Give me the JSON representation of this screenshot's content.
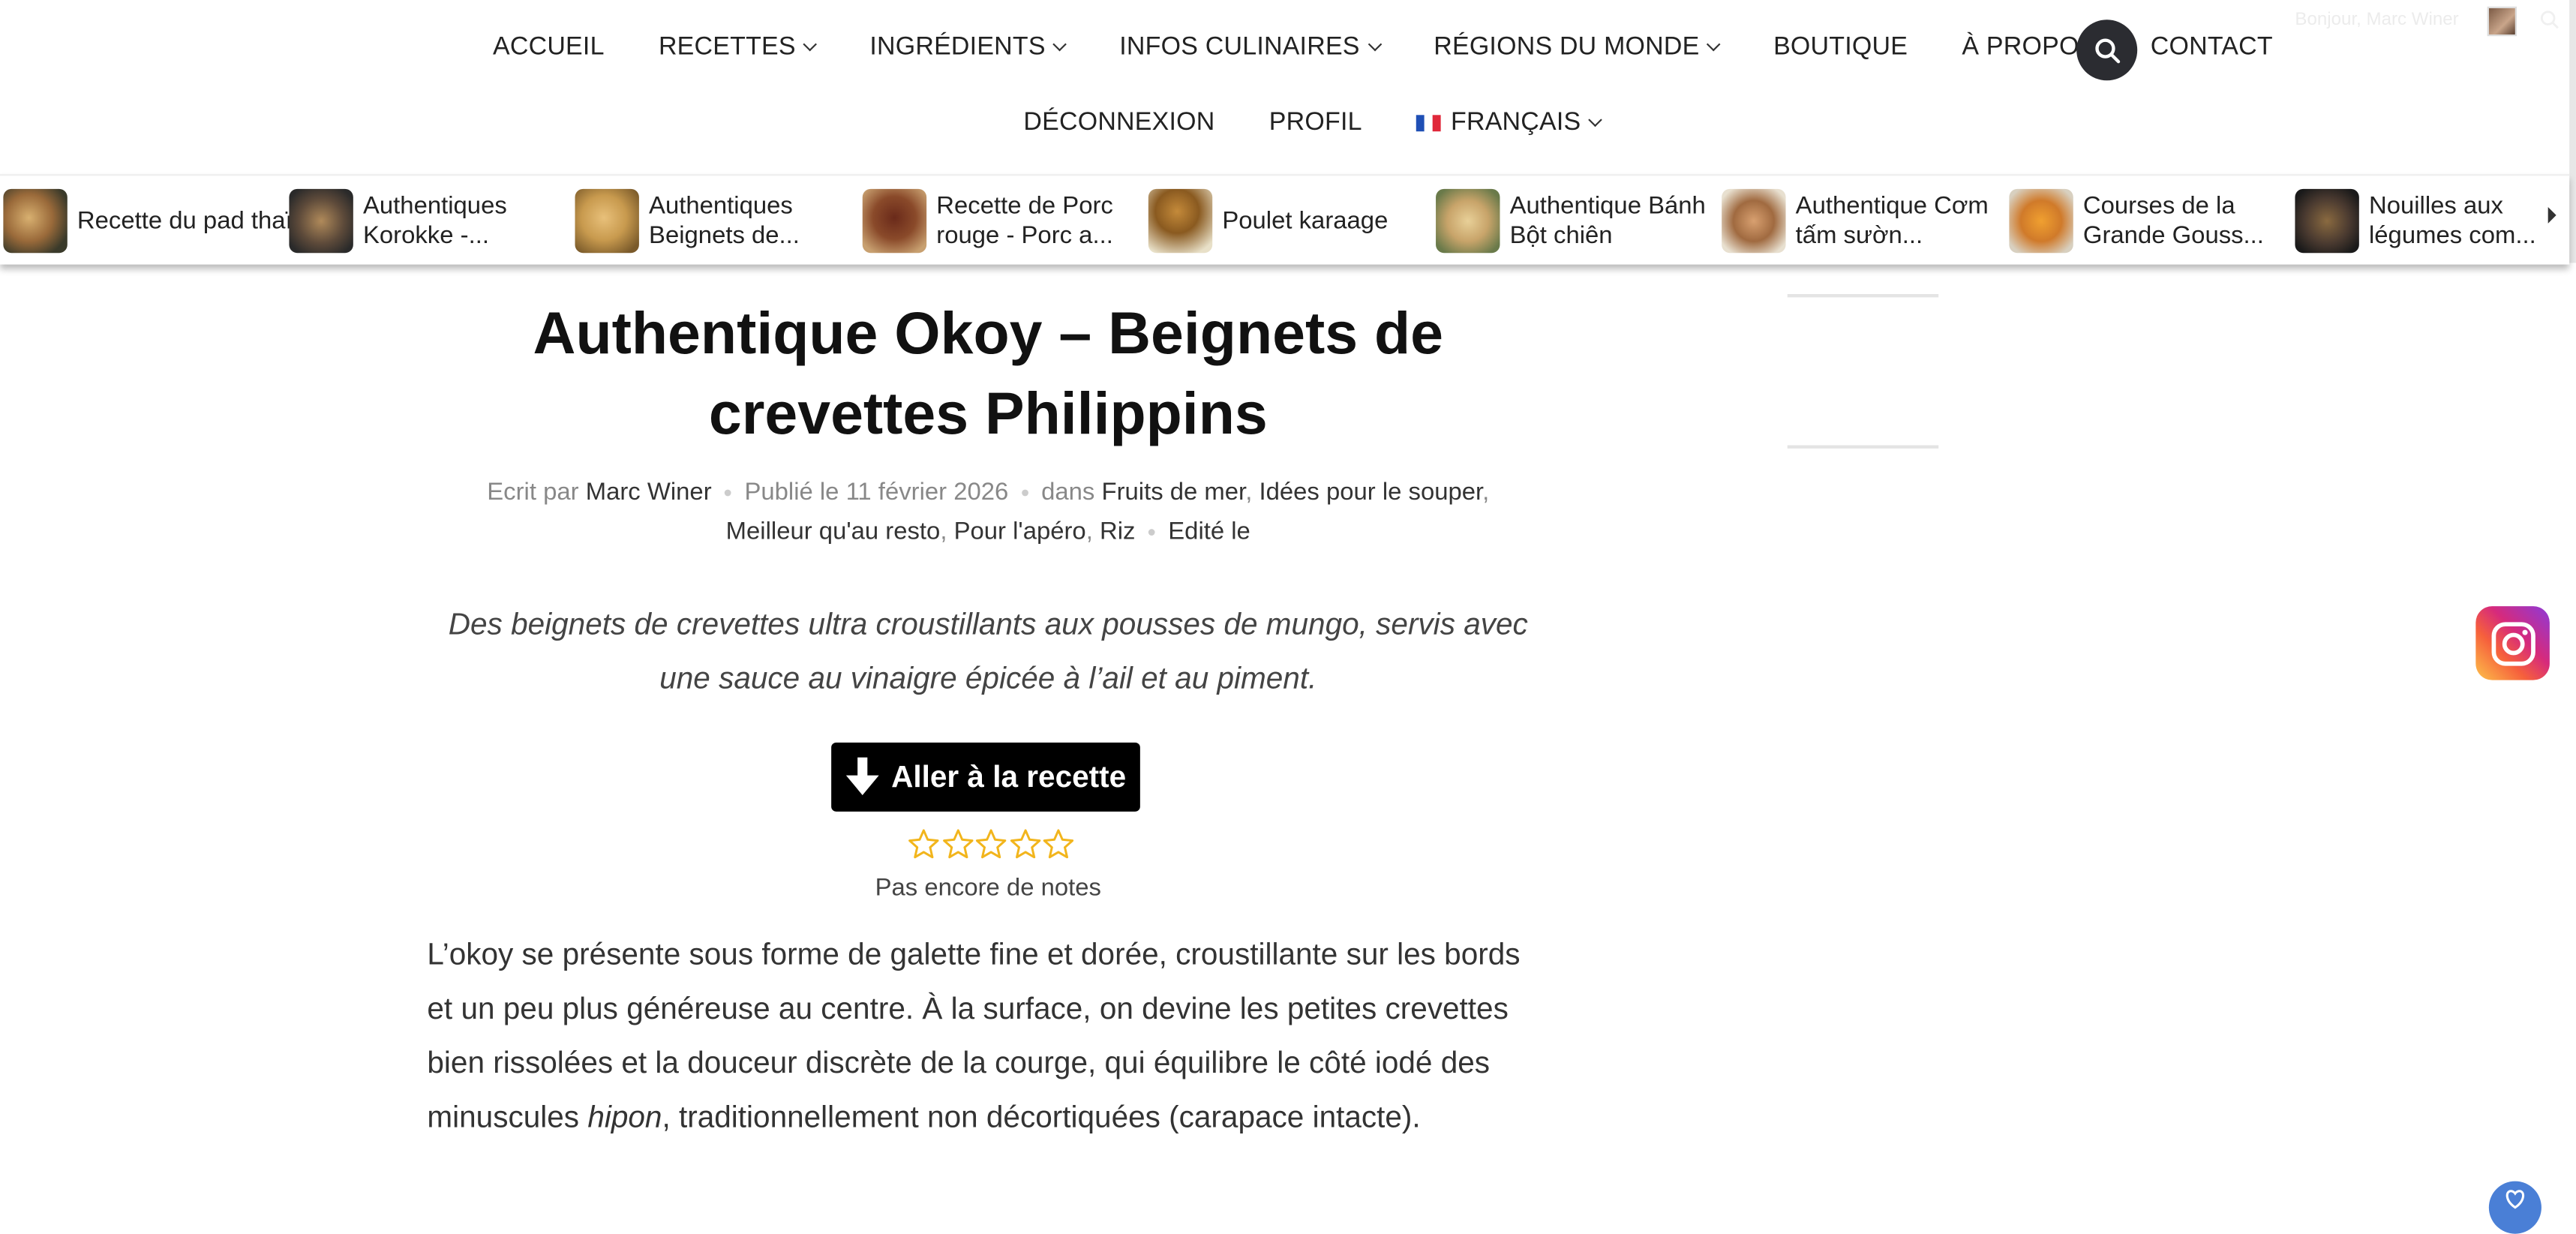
{
  "nav": {
    "row1": [
      {
        "label": "ACCUEIL",
        "dropdown": false
      },
      {
        "label": "RECETTES",
        "dropdown": true
      },
      {
        "label": "INGRÉDIENTS",
        "dropdown": true
      },
      {
        "label": "INFOS CULINAIRES",
        "dropdown": true
      },
      {
        "label": "RÉGIONS DU MONDE",
        "dropdown": true
      },
      {
        "label": "BOUTIQUE",
        "dropdown": false
      },
      {
        "label": "À PROPOS",
        "dropdown": false
      },
      {
        "label": "CONTACT",
        "dropdown": false
      }
    ],
    "row2": [
      {
        "label": "DÉCONNEXION"
      },
      {
        "label": "PROFIL"
      },
      {
        "label": "FRANÇAIS"
      }
    ],
    "user_greeting": "Bonjour, Marc Winer"
  },
  "carousel": [
    {
      "label": "Recette du pad thaï",
      "thumb_color": "#7a5a3a"
    },
    {
      "label": "Authentiques Korokke -...",
      "thumb_color": "#5d4a3a"
    },
    {
      "label": "Authentiques Beignets de...",
      "thumb_color": "#c89a4e"
    },
    {
      "label": "Recette de Porc rouge - Porc a...",
      "thumb_color": "#8a4a2a"
    },
    {
      "label": "Poulet karaage",
      "thumb_color": "#b07a34"
    },
    {
      "label": "Authentique Bánh Bột chiên",
      "thumb_color": "#c8a46a"
    },
    {
      "label": "Authentique Cơm tấm sườn...",
      "thumb_color": "#a06a40"
    },
    {
      "label": "Courses de la Grande Gouss...",
      "thumb_color": "#d07a2a"
    },
    {
      "label": "Nouilles aux légumes com...",
      "thumb_color": "#4a3a30"
    }
  ],
  "article": {
    "title": "Authentique Okoy – Beignets de crevettes Philippins",
    "meta": {
      "written_by": "Ecrit par",
      "author": "Marc Winer",
      "published": "Publié le 11 février 2026",
      "in": "dans",
      "categories": [
        "Fruits de mer",
        "Idées pour le souper",
        "Meilleur qu'au resto",
        "Pour l'apéro",
        "Riz"
      ],
      "edited": "Edité le"
    },
    "lede": "Des beignets de crevettes ultra croustillants aux pousses de mungo, servis avec une sauce au vinaigre épicée à l’ail et au piment.",
    "jump_button": "Aller à la recette",
    "rating_text": "Pas encore de notes",
    "body_before_italic": "L’okoy se présente sous forme de galette fine et dorée, croustillante sur les bords et un peu plus généreuse au centre. À la surface, on devine les petites crevettes bien rissolées et la douceur discrète de la courge, qui équilibre le côté iodé des minuscules ",
    "body_italic": "hipon",
    "body_after_italic": ", traditionnellement non décortiquées (carapace intacte)."
  },
  "colors": {
    "accent_star": "#f2b51c",
    "search_bg": "#2b2c31",
    "button_bg": "#000000"
  }
}
